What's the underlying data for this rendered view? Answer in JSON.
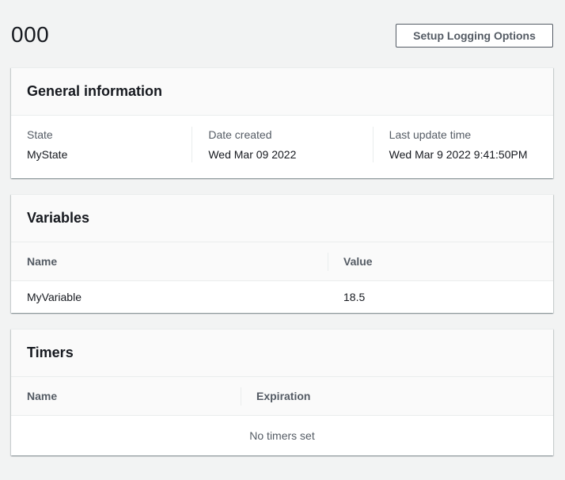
{
  "page": {
    "title": "000",
    "setup_logging_label": "Setup Logging Options"
  },
  "general": {
    "title": "General information",
    "fields": [
      {
        "label": "State",
        "value": "MyState"
      },
      {
        "label": "Date created",
        "value": "Wed Mar 09 2022"
      },
      {
        "label": "Last update time",
        "value": "Wed Mar 9 2022 9:41:50PM"
      }
    ]
  },
  "variables": {
    "title": "Variables",
    "columns": [
      "Name",
      "Value"
    ],
    "rows": [
      {
        "name": "MyVariable",
        "value": "18.5"
      }
    ]
  },
  "timers": {
    "title": "Timers",
    "columns": [
      "Name",
      "Expiration"
    ],
    "empty_text": "No timers set"
  }
}
